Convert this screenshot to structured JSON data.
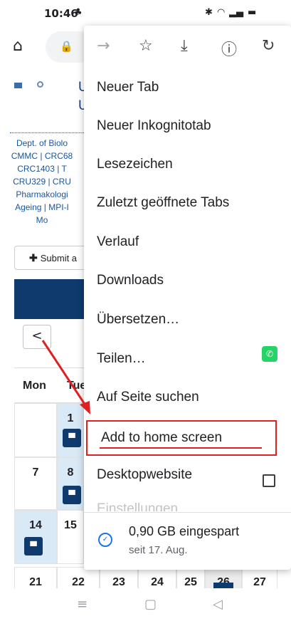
{
  "status_bar": {
    "time": "10:46",
    "icons": [
      "notification-icon",
      "bluetooth-icon",
      "wifi-icon",
      "signal-icon",
      "battery-icon"
    ]
  },
  "toolbar": {
    "icons": [
      "home-icon",
      "lock-icon"
    ]
  },
  "page": {
    "site_title_letters": [
      "U",
      "U"
    ],
    "dept_links": [
      "Dept. of Biolo",
      "CMMC | CRC68",
      "CRC1403 | T",
      "CRU329 | CRU",
      "Pharmakologi",
      "Ageing | MPI-I",
      "Mo"
    ],
    "submit_label": "Submit a",
    "prev_symbol": "<",
    "day_headers": [
      "Mon",
      "Tue"
    ],
    "calendar_numbers": {
      "row1": [
        "1"
      ],
      "row2": [
        "7",
        "8"
      ],
      "row3": [
        "14",
        "15"
      ],
      "row4": [
        "21",
        "22",
        "23",
        "24",
        "25",
        "26",
        "27"
      ]
    }
  },
  "menu": {
    "top_icons": [
      "forward-icon",
      "star-icon",
      "download-icon",
      "info-icon",
      "reload-icon"
    ],
    "items": [
      "Neuer Tab",
      "Neuer Inkognitotab",
      "Lesezeichen",
      "Zuletzt geöffnete Tabs",
      "Verlauf",
      "Downloads",
      "Übersetzen…",
      "Teilen…",
      "Auf Seite suchen",
      "Add to home screen",
      "Desktopwebsite",
      "Einstellungen"
    ],
    "data_saver": {
      "amount": "0,90 GB eingespart",
      "since": "seit 17. Aug."
    }
  },
  "annotation": {
    "color": "#e02020",
    "highlighted_item": "Add to home screen"
  },
  "navbar": {
    "icons": [
      "menu-icon",
      "home-square-icon",
      "back-triangle-icon"
    ]
  },
  "colors": {
    "calendar_dark": "#0e3a6e",
    "calendar_highlight": "#d9e9f6",
    "link_blue": "#1a56a0",
    "whatsapp_green": "#25d366",
    "saver_blue": "#1a73e8"
  }
}
